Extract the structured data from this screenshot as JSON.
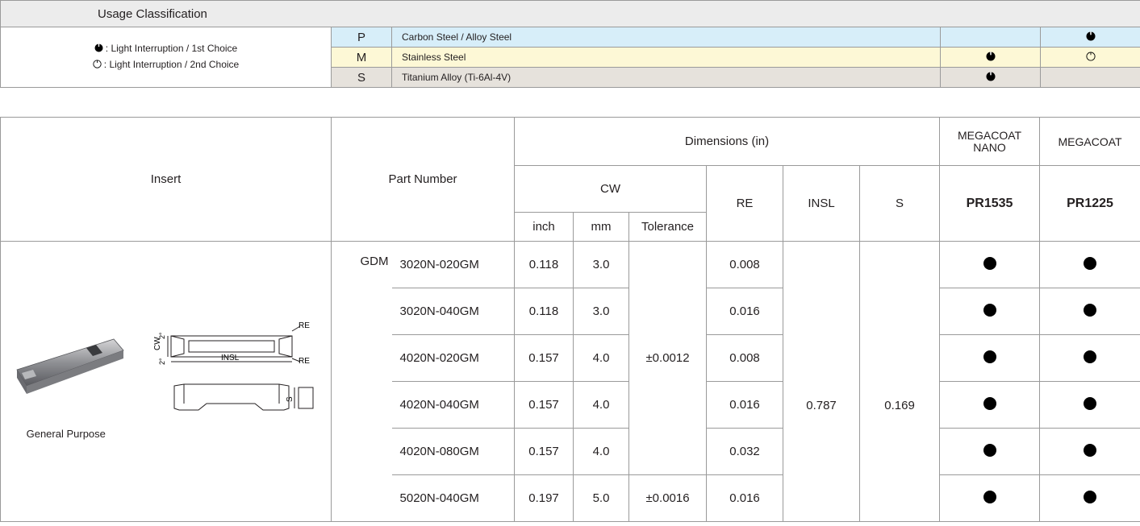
{
  "usage": {
    "title": "Usage Classification",
    "legend_first": ": Light Interruption / 1st Choice",
    "legend_second": ": Light Interruption / 2nd Choice",
    "rows": [
      {
        "code": "P",
        "material": "Carbon Steel / Alloy Steel",
        "pr1535": "",
        "pr1225": "first",
        "color": "#d7eef9"
      },
      {
        "code": "M",
        "material": "Stainless Steel",
        "pr1535": "first",
        "pr1225": "second",
        "color": "#fdf8d6"
      },
      {
        "code": "S",
        "material": "Titanium Alloy (Ti-6Al-4V)",
        "pr1535": "first",
        "pr1225": "",
        "color": "#e6e2dc"
      }
    ]
  },
  "header": {
    "insert": "Insert",
    "part_number": "Part Number",
    "dimensions": "Dimensions (in)",
    "cw": "CW",
    "inch": "inch",
    "mm": "mm",
    "tolerance": "Tolerance",
    "re": "RE",
    "insl": "INSL",
    "s": "S",
    "grade1_coat": "MEGACOAT NANO",
    "grade2_coat": "MEGACOAT",
    "grade1": "PR1535",
    "grade2": "PR1225"
  },
  "insert": {
    "type_label": "General Purpose",
    "series": "GDM",
    "drawing_labels": {
      "re": "RE",
      "insl": "INSL",
      "cw": "CW",
      "s": "S",
      "angle": "2°"
    }
  },
  "rows": [
    {
      "part": "3020N-020GM",
      "inch": "0.118",
      "mm": "3.0",
      "re": "0.008"
    },
    {
      "part": "3020N-040GM",
      "inch": "0.118",
      "mm": "3.0",
      "re": "0.016"
    },
    {
      "part": "4020N-020GM",
      "inch": "0.157",
      "mm": "4.0",
      "re": "0.008"
    },
    {
      "part": "4020N-040GM",
      "inch": "0.157",
      "mm": "4.0",
      "re": "0.016"
    },
    {
      "part": "4020N-080GM",
      "inch": "0.157",
      "mm": "4.0",
      "re": "0.032"
    },
    {
      "part": "5020N-040GM",
      "inch": "0.197",
      "mm": "5.0",
      "re": "0.016"
    }
  ],
  "tolerances": {
    "group1": "±0.0012",
    "group2": "±0.0016"
  },
  "insl_value": "0.787",
  "s_value": "0.169"
}
